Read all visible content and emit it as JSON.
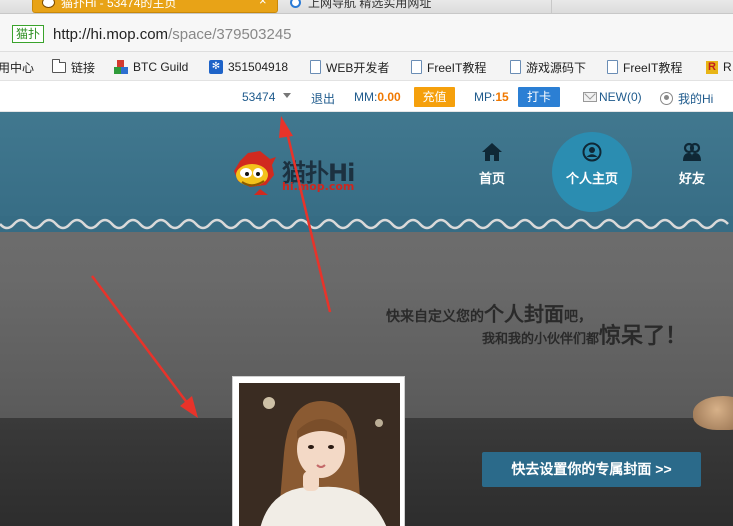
{
  "browser": {
    "active_tab_title": "猫扑Hi - 53474的主页",
    "second_tab_title": "上网导航 精选实用网址",
    "address_badge": "猫扑",
    "url_host": "http://hi.mop.com",
    "url_path": "/space/379503245"
  },
  "bookmarks": [
    {
      "label": "用中心",
      "icon": "none"
    },
    {
      "label": "链接",
      "icon": "folder-icon"
    },
    {
      "label": "BTC Guild",
      "icon": "cube-icon"
    },
    {
      "label": "351504918",
      "icon": "paw-icon"
    },
    {
      "label": "WEB开发者",
      "icon": "page-icon"
    },
    {
      "label": "FreeIT教程",
      "icon": "page-icon"
    },
    {
      "label": "游戏源码下",
      "icon": "page-icon"
    },
    {
      "label": "FreeIT教程",
      "icon": "page-icon"
    },
    {
      "label": "R",
      "icon": "r-icon"
    }
  ],
  "sitebar": {
    "username": "53474",
    "logout": "退出",
    "mm_label": "MM:",
    "mm_value": "0.00",
    "recharge": "充值",
    "mp_label": "MP:",
    "mp_value": "15",
    "checkin": "打卡",
    "new_label": "NEW",
    "new_count": "(0)",
    "my_hi": "我的Hi"
  },
  "header": {
    "logo_text": "猫扑Hi",
    "logo_sub": "hi.mop.com",
    "nav": [
      {
        "label": "首页",
        "icon": "home-icon",
        "active": false
      },
      {
        "label": "个人主页",
        "icon": "user-circle-icon",
        "active": true
      },
      {
        "label": "好友",
        "icon": "friends-icon",
        "active": false
      }
    ]
  },
  "cover": {
    "slogan_line1_a": "快来自定义您的",
    "slogan_line1_b": "个人封面",
    "slogan_line1_c": "吧，",
    "slogan_line2_a": "我和我的小伙伴们都",
    "slogan_line2_b": "惊呆了！",
    "set_cover_button": "快去设置你的专属封面 >>"
  },
  "colors": {
    "header_band": "#3b7188",
    "active_nav_circle": "#2b8db1",
    "recharge": "#f5a00c",
    "checkin": "#2b7fd4",
    "annotation_arrow": "#e8332a"
  }
}
